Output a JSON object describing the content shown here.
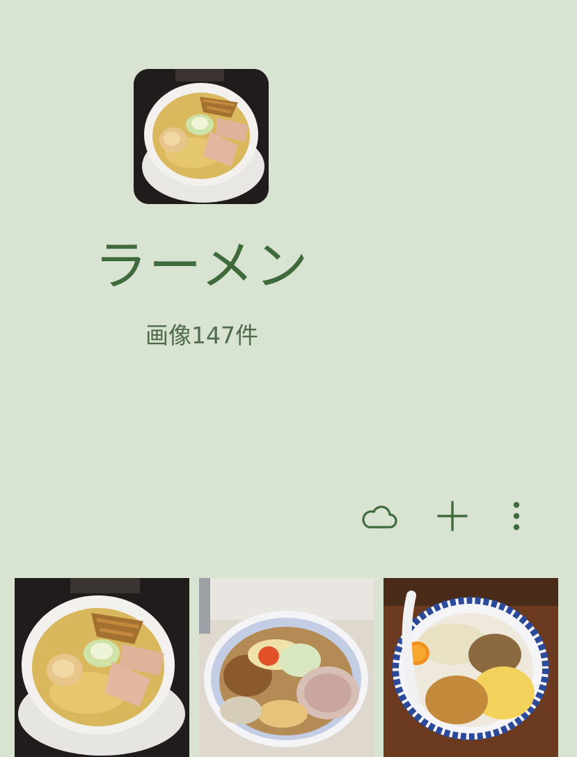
{
  "album": {
    "title": "ラーメン",
    "count": "画像147件",
    "cover_image": "ramen-bowl-with-egg-and-chashu-photo"
  },
  "toolbar": {
    "icons": [
      "cloud-icon",
      "plus-icon",
      "more-vert-icon"
    ],
    "accent_color": "#3f6a3c"
  },
  "thumbnails": [
    {
      "image": "shio-ramen-with-egg-and-menma-photo"
    },
    {
      "image": "mazesoba-with-chashu-and-egg-yolk-photo"
    },
    {
      "image": "abura-soba-with-cheese-and-egg-yolk-photo"
    }
  ],
  "colors": {
    "background": "#d8e3d1",
    "title": "#3f6a3c",
    "subtitle": "#4e6a4a"
  }
}
